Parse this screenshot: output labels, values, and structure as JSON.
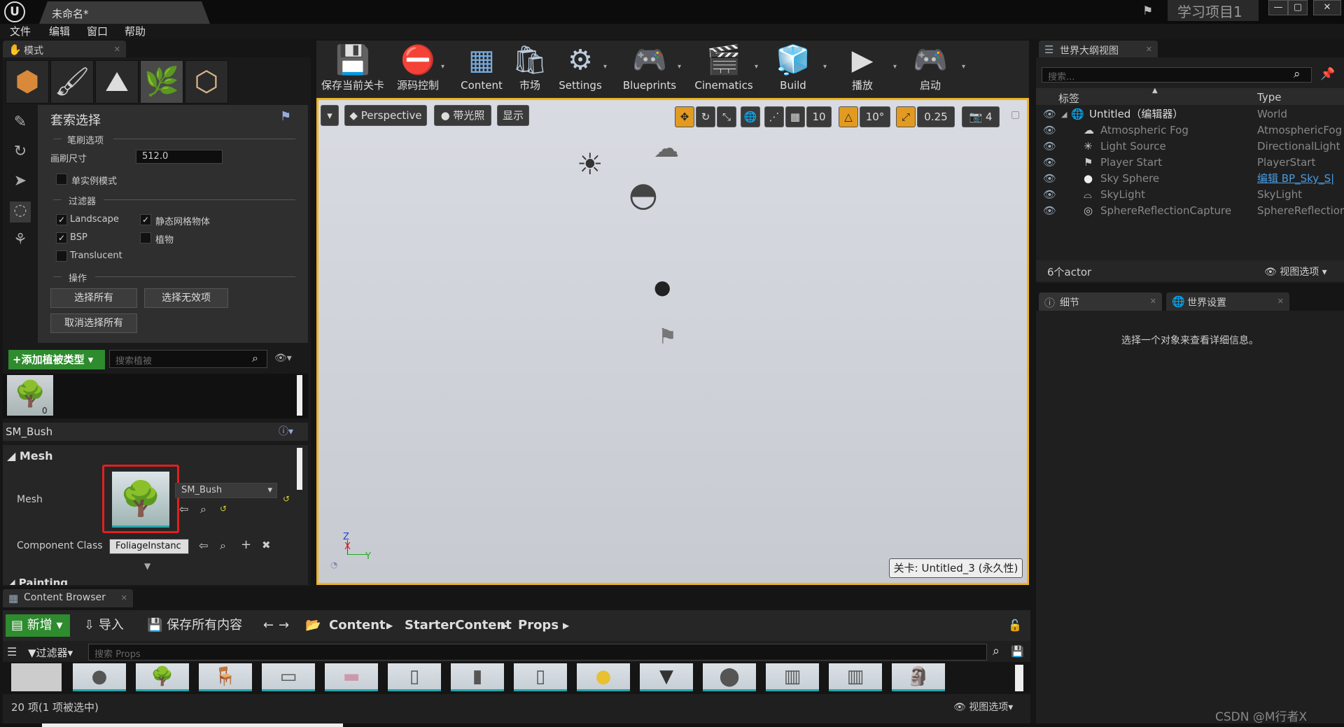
{
  "window": {
    "tab": "未命名*",
    "project": "学习项目1",
    "min": "—",
    "max": "▢",
    "close": "✕"
  },
  "menu": [
    "文件",
    "编辑",
    "窗口",
    "帮助"
  ],
  "modes": {
    "tab": "模式",
    "panel_title": "套索选择",
    "brush_options": "笔刷选项",
    "brush_size_label": "画刷尺寸",
    "brush_size": "512.0",
    "single_instance": "单实例模式",
    "filters_label": "过滤器",
    "landscape": "Landscape",
    "static_mesh": "静态网格物体",
    "bsp": "BSP",
    "foliage": "植物",
    "translucent": "Translucent",
    "ops_label": "操作",
    "select_all": "选择所有",
    "select_invalid": "选择无效项",
    "deselect_all": "取消选择所有",
    "add_foliage": "+添加植被类型",
    "search_foliage_placeholder": "搜索植被",
    "foliage_count": "0",
    "selected_foliage": "SM_Bush",
    "mesh_section": "Mesh",
    "mesh_label": "Mesh",
    "mesh_value": "SM_Bush",
    "component_class_label": "Component Class",
    "component_class_value": "FoliageInstanc",
    "painting_section": "Painting"
  },
  "toolbar": [
    {
      "label": "保存当前关卡",
      "icon": "💾"
    },
    {
      "label": "源码控制",
      "icon": "⛔"
    },
    {
      "label": "Content",
      "icon": "▦"
    },
    {
      "label": "市场",
      "icon": "🛍"
    },
    {
      "label": "Settings",
      "icon": "⚙"
    },
    {
      "label": "Blueprints",
      "icon": "🎮"
    },
    {
      "label": "Cinematics",
      "icon": "🎬"
    },
    {
      "label": "Build",
      "icon": "🧊"
    },
    {
      "label": "播放",
      "icon": "▶"
    },
    {
      "label": "启动",
      "icon": "🎮"
    }
  ],
  "viewport": {
    "perspective": "Perspective",
    "lit": "带光照",
    "show": "显示",
    "grid_snap": "10",
    "rot_snap": "10°",
    "scale_snap": "0.25",
    "cam_speed": "4",
    "level_label": "关卡: Untitled_3 (永久性)",
    "axis_z": "Z",
    "axis_x": "X",
    "axis_y": "Y"
  },
  "outliner": {
    "tab": "世界大纲视图",
    "search_placeholder": "搜索...",
    "col_label": "标签",
    "col_type": "Type",
    "rows": [
      {
        "label": "Untitled（编辑器）",
        "type": "World",
        "icon": "🌐"
      },
      {
        "label": "Atmospheric Fog",
        "type": "AtmosphericFog",
        "icon": "☁"
      },
      {
        "label": "Light Source",
        "type": "DirectionalLight",
        "icon": "✳"
      },
      {
        "label": "Player Start",
        "type": "PlayerStart",
        "icon": "⚑"
      },
      {
        "label": "Sky Sphere",
        "type": "编辑 BP_Sky_S|",
        "icon": "●"
      },
      {
        "label": "SkyLight",
        "type": "SkyLight",
        "icon": "⌓"
      },
      {
        "label": "SphereReflectionCapture",
        "type": "SphereReflectior",
        "icon": "◎"
      }
    ],
    "count": "6个actor",
    "view_options": "视图选项"
  },
  "details": {
    "tab": "细节",
    "world_tab": "世界设置",
    "empty_msg": "选择一个对象来查看详细信息。"
  },
  "content_browser": {
    "tab": "Content Browser",
    "new": "新增",
    "import": "导入",
    "save_all": "保存所有内容",
    "path": [
      "Content",
      "StarterContent",
      "Props"
    ],
    "filter": "过滤器",
    "search_placeholder": "搜索 Props",
    "status": "20 项(1 项被选中)",
    "view_options": "视图选项"
  },
  "watermark": "CSDN @M行者X",
  "colors": {
    "accent": "#f0b41f",
    "green_btn": "#2e8b2e",
    "highlight_red": "#e02020",
    "link": "#4a9adf"
  }
}
